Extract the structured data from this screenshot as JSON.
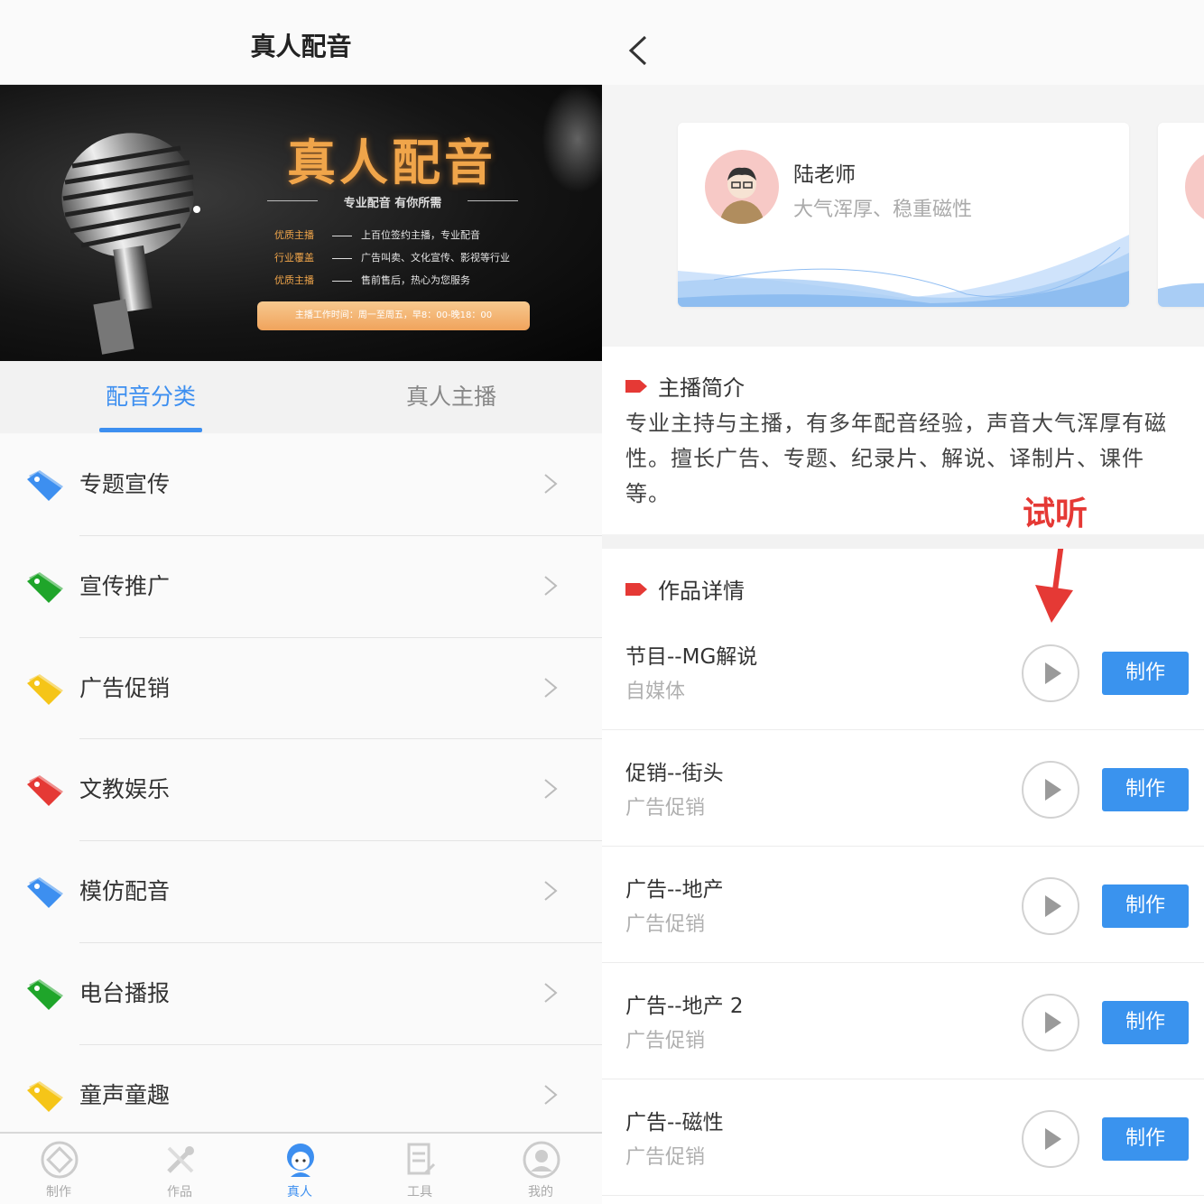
{
  "left": {
    "header": {
      "title": "真人配音"
    },
    "banner": {
      "title": "真人配音",
      "subtitle": "专业配音 有你所需",
      "rows": [
        {
          "key": "优质主播",
          "value": "上百位签约主播，专业配音"
        },
        {
          "key": "行业覆盖",
          "value": "广告叫卖、文化宣传、影视等行业"
        },
        {
          "key": "优质主播",
          "value": "售前售后，热心为您服务"
        }
      ],
      "button": "主播工作时间：周一至周五，早8：00-晚18：00"
    },
    "tabs": [
      {
        "label": "配音分类",
        "active": true
      },
      {
        "label": "真人主播",
        "active": false
      }
    ],
    "categories": [
      {
        "label": "专题宣传",
        "color": "#3d8ff0"
      },
      {
        "label": "宣传推广",
        "color": "#1fa52a"
      },
      {
        "label": "广告促销",
        "color": "#f5c518"
      },
      {
        "label": "文教娱乐",
        "color": "#e53935"
      },
      {
        "label": "模仿配音",
        "color": "#3d8ff0"
      },
      {
        "label": "电台播报",
        "color": "#1fa52a"
      },
      {
        "label": "童声童趣",
        "color": "#f5c518"
      }
    ],
    "tabbar": [
      {
        "label": "制作",
        "icon": "make-icon",
        "active": false
      },
      {
        "label": "作品",
        "icon": "works-icon",
        "active": false
      },
      {
        "label": "真人",
        "icon": "person-icon",
        "active": true
      },
      {
        "label": "工具",
        "icon": "tools-icon",
        "active": false
      },
      {
        "label": "我的",
        "icon": "profile-icon",
        "active": false
      }
    ]
  },
  "right": {
    "anchor": {
      "name": "陆老师",
      "desc": "大气浑厚、稳重磁性"
    },
    "intro": {
      "title": "主播简介",
      "text": "专业主持与主播，有多年配音经验，声音大气浑厚有磁性。擅长广告、专题、纪录片、解说、译制片、课件等。"
    },
    "annotation": "试听",
    "works": {
      "title": "作品详情",
      "make_label": "制作",
      "items": [
        {
          "title": "节目--MG解说",
          "tag": "自媒体"
        },
        {
          "title": "促销--街头",
          "tag": "广告促销"
        },
        {
          "title": "广告--地产",
          "tag": "广告促销"
        },
        {
          "title": "广告--地产 2",
          "tag": "广告促销"
        },
        {
          "title": "广告--磁性",
          "tag": "广告促销"
        }
      ]
    }
  },
  "colors": {
    "accent": "#3d8ff0",
    "make_button": "#3a93ee",
    "flag": "#e53935",
    "banner_gold": "#f0a54a"
  }
}
